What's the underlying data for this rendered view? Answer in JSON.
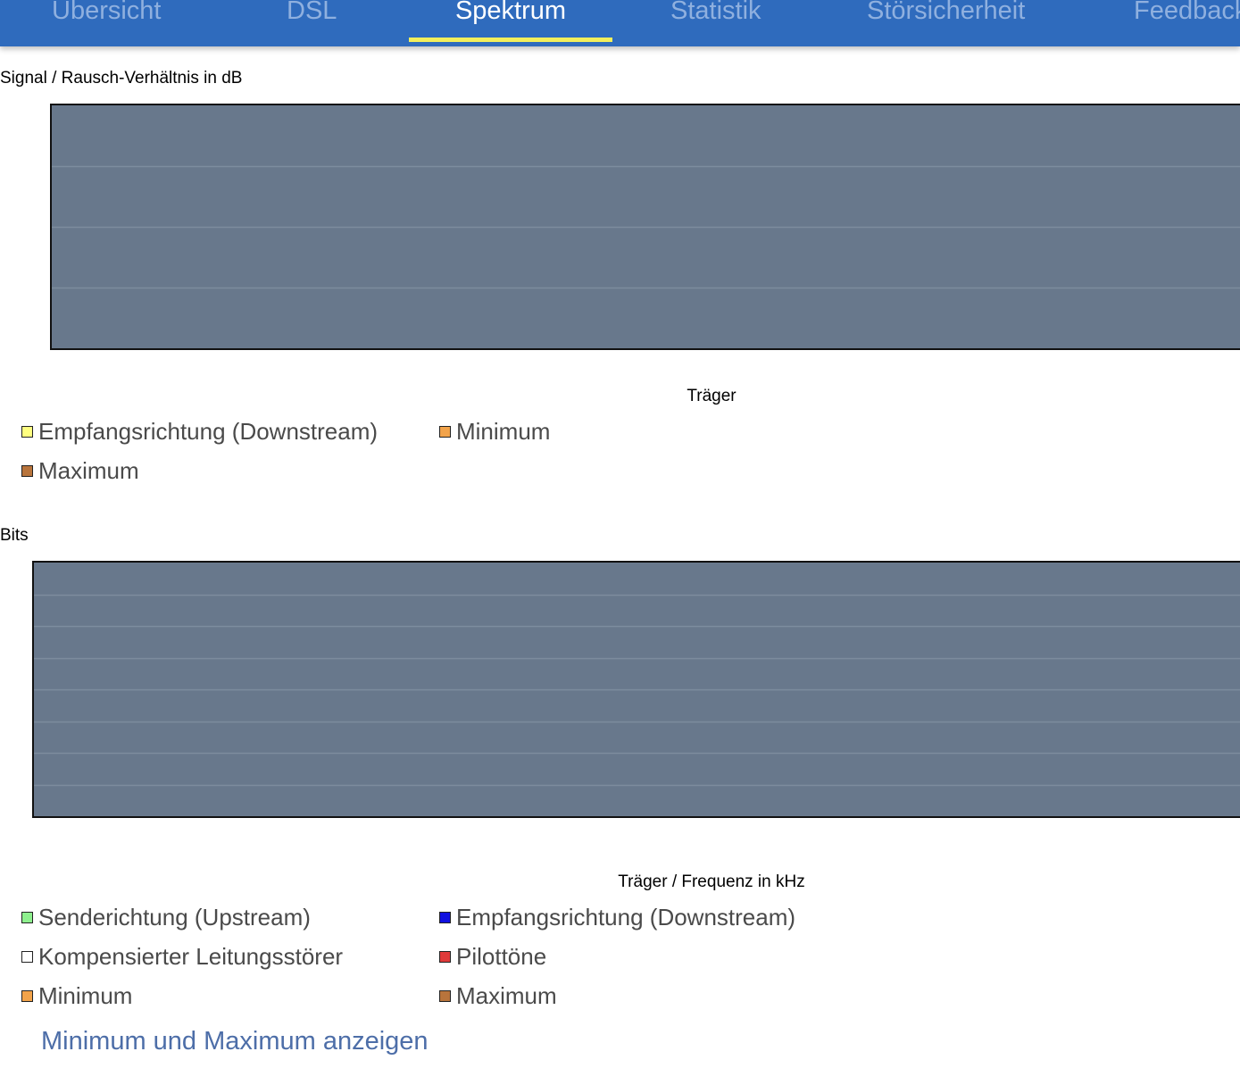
{
  "tabs": [
    {
      "label": "Übersicht",
      "active": false
    },
    {
      "label": "DSL",
      "active": false
    },
    {
      "label": "Spektrum",
      "active": true
    },
    {
      "label": "Statistik",
      "active": false
    },
    {
      "label": "Störsicherheit",
      "active": false
    },
    {
      "label": "Feedback",
      "active": false
    }
  ],
  "colors": {
    "tabbar": "#2f6bbd",
    "tab_inactive": "#8fb0df",
    "tab_active": "#ffffff",
    "tab_underline": "#f3ef5b",
    "plot_bg": "#68788c",
    "link": "#4d6ea8"
  },
  "snr_chart": {
    "ylabel": "Signal / Rausch-Verhältnis in dB",
    "xlabel": "Träger",
    "legend": [
      {
        "label": "Empfangsrichtung (Downstream)",
        "color": "#ffff80"
      },
      {
        "label": "Minimum",
        "color": "#f2a34a"
      },
      {
        "label": "Maximum",
        "color": "#b8743c"
      }
    ]
  },
  "bits_chart": {
    "ylabel": "Bits",
    "xlabel": "Träger / Frequenz in kHz",
    "legend": [
      {
        "label": "Senderichtung (Upstream)",
        "color": "#8ef08e"
      },
      {
        "label": "Empfangsrichtung (Downstream)",
        "color": "#1010e0"
      },
      {
        "label": "Kompensierter Leitungsstörer",
        "color": "#ffffff"
      },
      {
        "label": "Pilottöne",
        "color": "#e03a3a"
      },
      {
        "label": "Minimum",
        "color": "#f2a34a"
      },
      {
        "label": "Maximum",
        "color": "#b8743c"
      }
    ]
  },
  "chart_data": [
    {
      "type": "line",
      "ylabel": "Signal / Rausch-Verhältnis in dB",
      "xlabel": "Träger",
      "series": [
        {
          "name": "Empfangsrichtung (Downstream)",
          "values": []
        },
        {
          "name": "Minimum",
          "values": []
        },
        {
          "name": "Maximum",
          "values": []
        }
      ],
      "grid": true,
      "grid_lines": 3,
      "legend": "bottom"
    },
    {
      "type": "bar",
      "ylabel": "Bits",
      "xlabel": "Träger / Frequenz in kHz",
      "series": [
        {
          "name": "Senderichtung (Upstream)",
          "values": []
        },
        {
          "name": "Empfangsrichtung (Downstream)",
          "values": []
        },
        {
          "name": "Kompensierter Leitungsstörer",
          "values": []
        },
        {
          "name": "Pilottöne",
          "values": []
        },
        {
          "name": "Minimum",
          "values": []
        },
        {
          "name": "Maximum",
          "values": []
        }
      ],
      "grid": true,
      "grid_lines": 7,
      "legend": "bottom"
    }
  ],
  "toggle_link": "Minimum und Maximum anzeigen"
}
